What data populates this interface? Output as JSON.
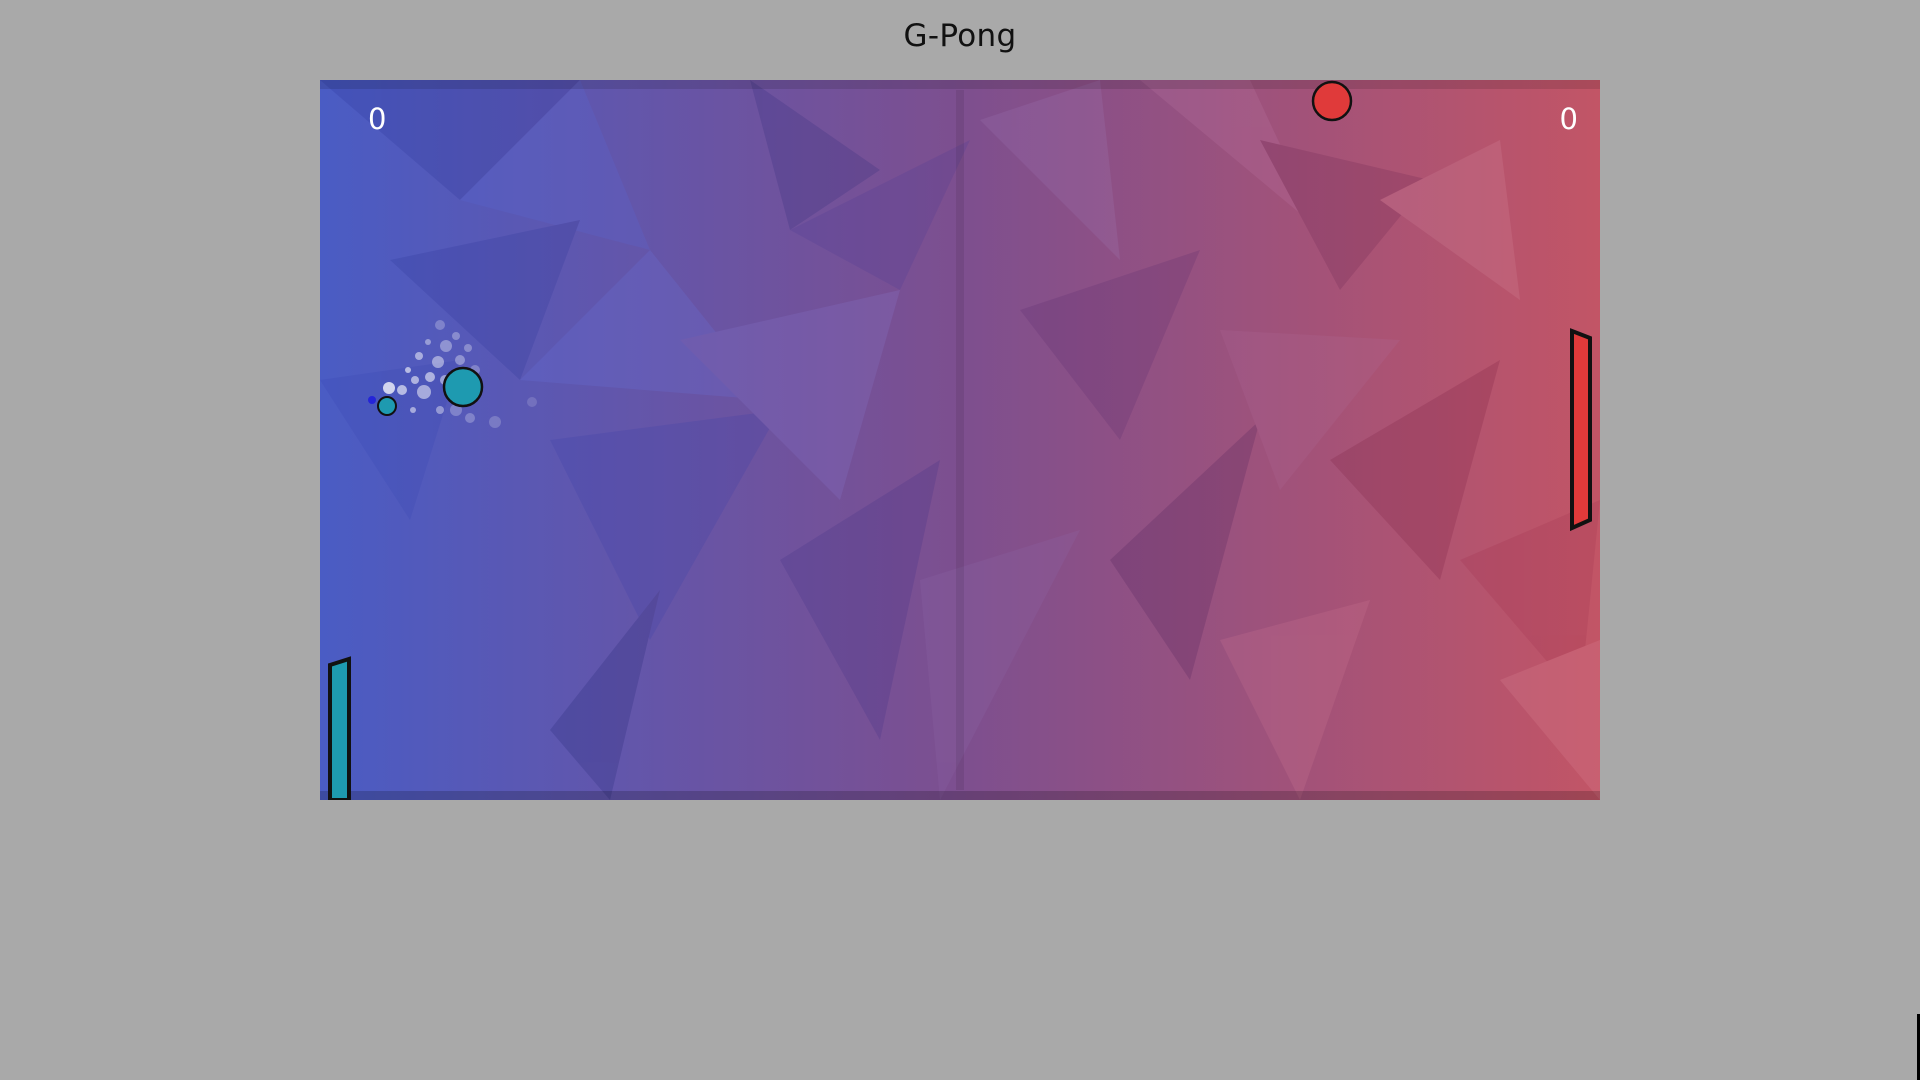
{
  "game": {
    "title": "G-Pong",
    "scores": {
      "left": "0",
      "right": "0"
    },
    "colors": {
      "page_background": "#a9a9a9",
      "arena_left": "#4a5cc4",
      "arena_mid": "#7d4f8f",
      "arena_right": "#c25566",
      "left_player": "#1e9ab0",
      "right_player": "#e03a3a",
      "outline": "#111111"
    },
    "icons": {
      "main_ball": "circle",
      "secondary_ball": "circle",
      "powerup_ball": "circle"
    }
  }
}
